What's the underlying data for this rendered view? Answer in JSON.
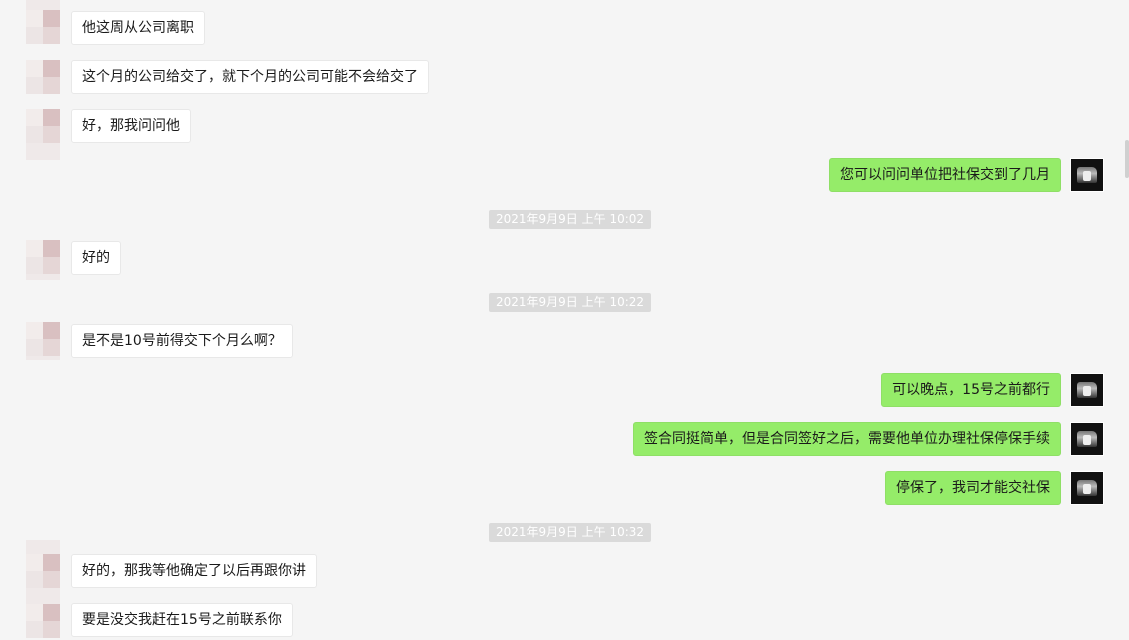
{
  "messages": [
    {
      "side": "other",
      "text": "他这周从公司离职"
    },
    {
      "side": "other",
      "text": "这个月的公司给交了，就下个月的公司可能不会给交了"
    },
    {
      "side": "other",
      "text": "好，那我问问他"
    },
    {
      "side": "self",
      "text": "您可以问问单位把社保交到了几月"
    },
    {
      "timestamp": "2021年9月9日 上午 10:02"
    },
    {
      "side": "other",
      "text": "好的"
    },
    {
      "timestamp": "2021年9月9日 上午 10:22"
    },
    {
      "side": "other",
      "text": "是不是10号前得交下个月么啊？"
    },
    {
      "side": "self",
      "text": "可以晚点，15号之前都行"
    },
    {
      "side": "self",
      "text": "签合同挺简单，但是合同签好之后，需要他单位办理社保停保手续"
    },
    {
      "side": "self",
      "text": "停保了，我司才能交社保"
    },
    {
      "timestamp": "2021年9月9日 上午 10:32"
    },
    {
      "side": "other",
      "text": "好的，那我等他确定了以后再跟你讲"
    },
    {
      "side": "other",
      "text": "要是没交我赶在15号之前联系你"
    }
  ],
  "colors": {
    "background": "#f5f5f5",
    "self_bubble": "#95ec69",
    "other_bubble": "#ffffff",
    "timestamp_bg": "#dadada"
  },
  "icons": {
    "other_avatar": "avatar-icon",
    "self_avatar": "avatar-icon"
  }
}
